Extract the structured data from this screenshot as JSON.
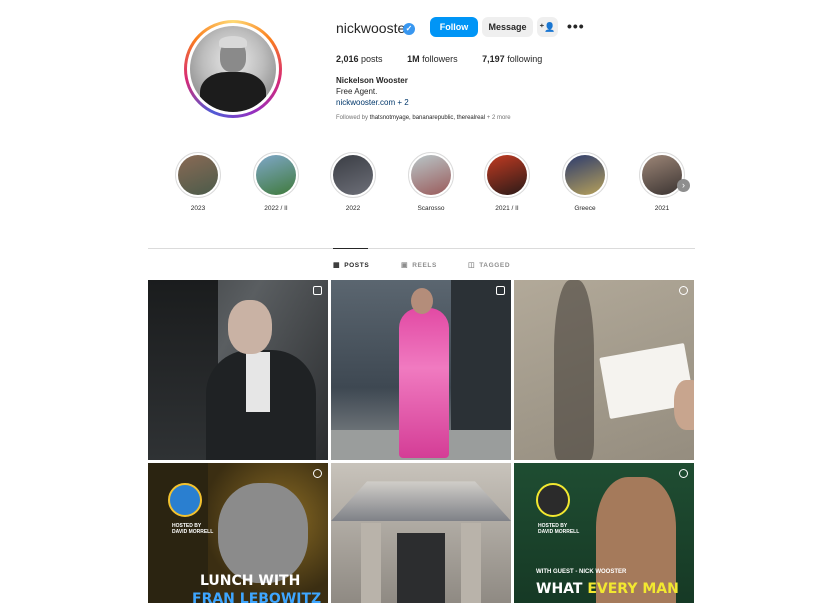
{
  "profile": {
    "username": "nickwooster",
    "verified": true,
    "buttons": {
      "follow": "Follow",
      "message": "Message",
      "suggest": "⁺👤",
      "more": "•••"
    },
    "stats": {
      "posts_count": "2,016",
      "posts_label": "posts",
      "followers_count": "1M",
      "followers_label": "followers",
      "following_count": "7,197",
      "following_label": "following"
    },
    "full_name": "Nickelson Wooster",
    "bio": "Free Agent.",
    "link": "nickwooster.com",
    "link_more": "+ 2",
    "followed_by_prefix": "Followed by",
    "followed_by_names": "thatsnotmyage, bananarepublic, therealreal",
    "followed_by_more": "+ 2 more"
  },
  "highlights": [
    {
      "label": "2023",
      "colors": [
        "#8a6a55",
        "#4b5b4a"
      ]
    },
    {
      "label": "2022 / II",
      "colors": [
        "#7fa7c9",
        "#3f7a3b"
      ]
    },
    {
      "label": "2022",
      "colors": [
        "#3a3d44",
        "#6d6f78"
      ]
    },
    {
      "label": "Scarosso",
      "colors": [
        "#b9c7c9",
        "#9a5a5a"
      ]
    },
    {
      "label": "2021 / II",
      "colors": [
        "#c23b22",
        "#2a1a18"
      ]
    },
    {
      "label": "Greece",
      "colors": [
        "#2c3b6e",
        "#b7a15a"
      ]
    },
    {
      "label": "2021",
      "colors": [
        "#9d8677",
        "#3b3432"
      ]
    }
  ],
  "tabs": [
    {
      "label": "POSTS",
      "icon": "▦",
      "active": true
    },
    {
      "label": "REELS",
      "icon": "▣",
      "active": false
    },
    {
      "label": "TAGGED",
      "icon": "◫",
      "active": false
    }
  ],
  "posts": {
    "p4": {
      "hosted": "HOSTED BY\nDAVID MORRELL",
      "line1": "LUNCH WITH",
      "line2": "FRAN LEBOWITZ"
    },
    "p6": {
      "hosted": "HOSTED BY\nDAVID MORRELL",
      "guest": "WITH GUEST - NICK WOOSTER",
      "line1_a": "WHAT ",
      "line1_b": "EVERY MAN"
    }
  }
}
